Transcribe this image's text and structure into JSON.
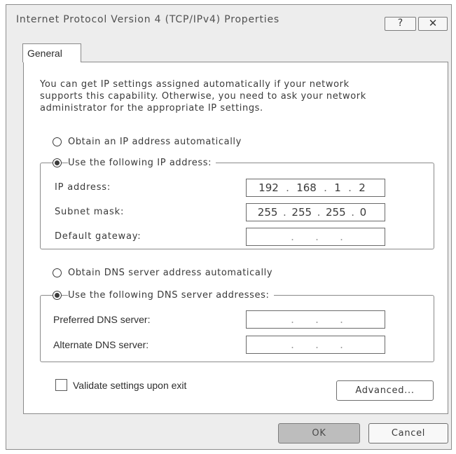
{
  "window": {
    "title": "Internet Protocol Version 4 (TCP/IPv4) Properties",
    "help_label": "?",
    "close_label": "✕"
  },
  "tabs": [
    {
      "label": "General",
      "active": true
    }
  ],
  "general": {
    "intro": "You can get IP settings assigned automatically if your network\nsupports this capability. Otherwise, you need to ask your network\nadministrator for the appropriate IP settings.",
    "ip_auto": {
      "label": "Obtain an IP address automatically",
      "checked": false
    },
    "ip_manual": {
      "label": "Use the following IP address:",
      "checked": true
    },
    "ip_fields": [
      {
        "label": "IP address:",
        "octets": [
          "192",
          "168",
          "1",
          "2"
        ]
      },
      {
        "label": "Subnet mask:",
        "octets": [
          "255",
          "255",
          "255",
          "0"
        ]
      },
      {
        "label": "Default gateway:",
        "octets": [
          "",
          "",
          "",
          ""
        ]
      }
    ],
    "dns_auto": {
      "label": "Obtain DNS server address automatically",
      "checked": false
    },
    "dns_manual": {
      "label": "Use the following DNS server addresses:",
      "checked": true
    },
    "dns_fields": [
      {
        "label": "Preferred DNS server:",
        "octets": [
          "",
          "",
          "",
          ""
        ]
      },
      {
        "label": "Alternate DNS server:",
        "octets": [
          "",
          "",
          "",
          ""
        ]
      }
    ],
    "validate": {
      "label": "Validate settings upon exit",
      "checked": false
    },
    "advanced_label": "Advanced..."
  },
  "footer": {
    "ok_label": "OK",
    "cancel_label": "Cancel"
  }
}
